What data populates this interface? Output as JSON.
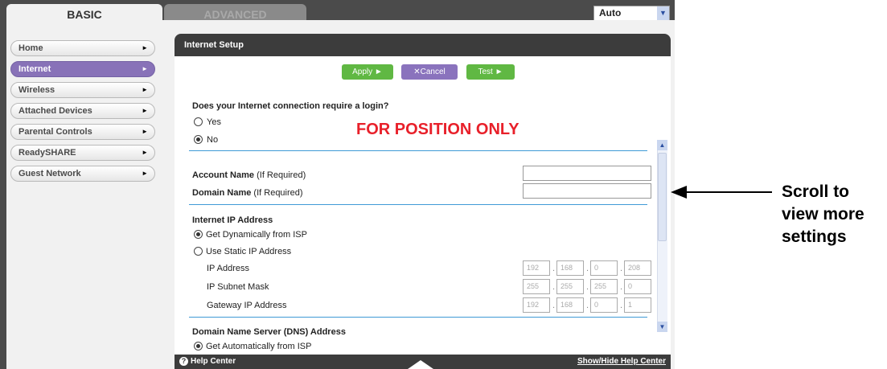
{
  "tabs": {
    "basic": "BASIC",
    "advanced": "ADVANCED"
  },
  "language": {
    "selected": "Auto"
  },
  "nav": {
    "items": [
      {
        "label": "Home"
      },
      {
        "label": "Internet"
      },
      {
        "label": "Wireless"
      },
      {
        "label": "Attached Devices"
      },
      {
        "label": "Parental Controls"
      },
      {
        "label": "ReadySHARE"
      },
      {
        "label": "Guest Network"
      }
    ]
  },
  "panel": {
    "title": "Internet Setup",
    "buttons": {
      "apply": "Apply ►",
      "cancel": "Cancel",
      "test": "Test ►"
    },
    "login_question": "Does your Internet connection require a login?",
    "yes": "Yes",
    "no": "No",
    "fpo": "FOR POSITION ONLY",
    "account_name": "Account Name",
    "domain_name": "Domain Name",
    "if_required": "(If Required)",
    "internet_ip_heading": "Internet IP Address",
    "get_dynamic": "Get Dynamically from ISP",
    "use_static": "Use Static IP Address",
    "ip_address_label": "IP Address",
    "subnet_label": "IP Subnet Mask",
    "gateway_label": "Gateway IP Address",
    "ip_address": [
      "192",
      "168",
      "0",
      "208"
    ],
    "subnet": [
      "255",
      "255",
      "255",
      "0"
    ],
    "gateway": [
      "192",
      "168",
      "0",
      "1"
    ],
    "dns_heading": "Domain Name Server (DNS) Address",
    "dns_auto": "Get Automatically from ISP"
  },
  "footer": {
    "help": "Help Center",
    "show_hide": "Show/Hide Help Center"
  },
  "callout": {
    "line1": "Scroll to",
    "line2": "view more",
    "line3": "settings"
  },
  "colors": {
    "accent_purple": "#8872b8",
    "button_green": "#60b843",
    "divider_blue": "#3f9ad6",
    "fpo_red": "#e8202a",
    "chrome_dark": "#3c3c3c"
  }
}
